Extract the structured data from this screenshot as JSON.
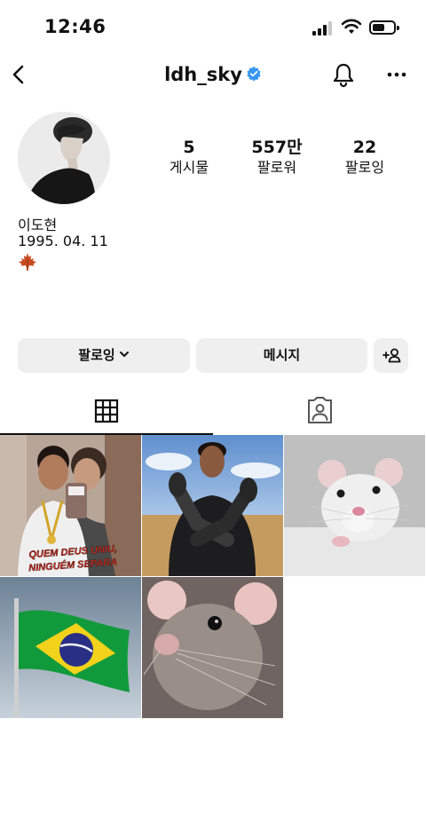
{
  "status_bar": {
    "time": "12:46"
  },
  "header": {
    "username": "ldh_sky"
  },
  "profile": {
    "stats": [
      {
        "number": "5",
        "label": "게시물"
      },
      {
        "number": "557만",
        "label": "팔로워"
      },
      {
        "number": "22",
        "label": "팔로잉"
      }
    ],
    "name": "이도현",
    "birthdate": "1995. 04. 11"
  },
  "actions": {
    "following_label": "팔로잉",
    "message_label": "메시지"
  },
  "posts": [
    {
      "caption_line1": "QUEM DEUS UNIU,",
      "caption_line2": "NINGUÉM SEPARA"
    }
  ],
  "colors": {
    "verified": "#3897f0",
    "button_bg": "#efefef",
    "text": "#111111"
  }
}
